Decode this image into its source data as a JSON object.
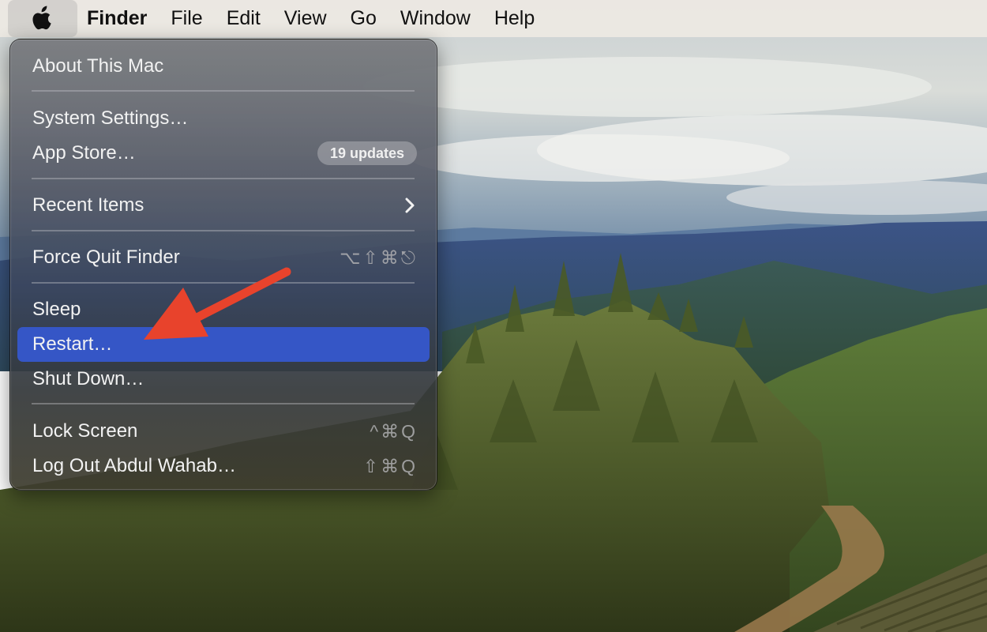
{
  "menubar": {
    "apple_icon": "apple-logo-icon",
    "items": [
      "Finder",
      "File",
      "Edit",
      "View",
      "Go",
      "Window",
      "Help"
    ]
  },
  "apple_menu": {
    "about": "About This Mac",
    "system_settings": "System Settings…",
    "app_store": "App Store…",
    "app_store_badge": "19 updates",
    "recent_items": "Recent Items",
    "recent_items_icon": "chevron-right-icon",
    "force_quit": "Force Quit Finder",
    "force_quit_shortcut": [
      "⌥",
      "⇧",
      "⌘",
      "⎋"
    ],
    "sleep": "Sleep",
    "restart": "Restart…",
    "shut_down": "Shut Down…",
    "lock_screen": "Lock Screen",
    "lock_screen_shortcut": [
      "^",
      "⌘",
      "Q"
    ],
    "log_out": "Log Out Abdul Wahab…",
    "log_out_shortcut": [
      "⇧",
      "⌘",
      "Q"
    ],
    "highlighted_item": "Restart…"
  },
  "annotation": {
    "type": "red-arrow",
    "points_to": "Restart…",
    "color": "#e8432c"
  },
  "colors": {
    "highlight": "#3556c6",
    "menubar": "#ece8e2",
    "arrow": "#e8432c"
  }
}
